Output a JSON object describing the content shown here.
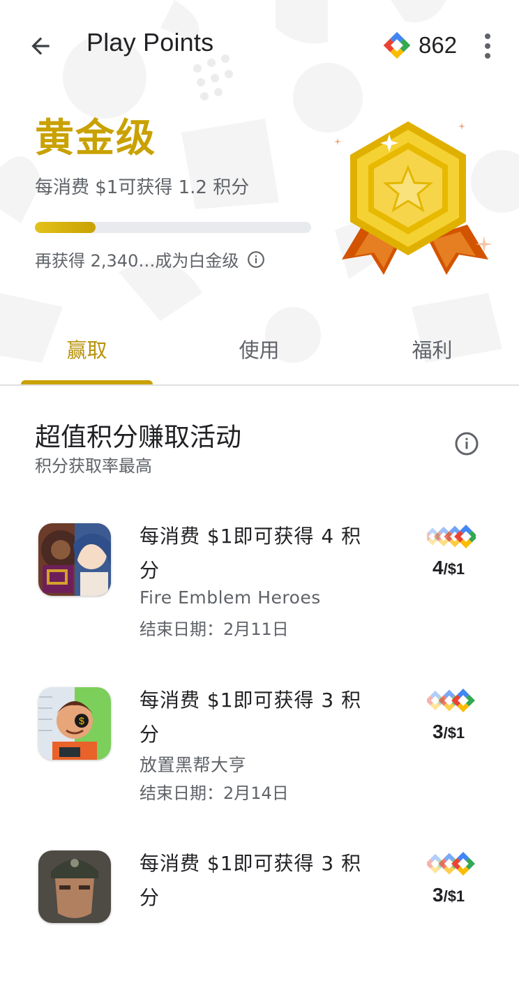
{
  "appbar": {
    "title": "Play Points",
    "points_balance": "862",
    "icons": {
      "back": "arrow-back-icon",
      "points": "play-points-icon",
      "menu": "more-vert-icon"
    }
  },
  "tier": {
    "name": "黄金级",
    "rate": "每消费 $1可获得 1.2 积分",
    "progress_fraction": 0.22,
    "next_level_text": "再获得 2,340…成为白金级",
    "accent_color": "#c9a100",
    "badge_icon": "gold-medal-icon"
  },
  "tabs": [
    {
      "label": "赢取",
      "active": true
    },
    {
      "label": "使用",
      "active": false
    },
    {
      "label": "福利",
      "active": false
    }
  ],
  "section": {
    "title": "超值积分赚取活动",
    "subtitle": "积分获取率最高"
  },
  "offers": [
    {
      "headline": "每消费 $1即可获得 4 积分",
      "app_name": "Fire Emblem Heroes",
      "end_date": "结束日期：2月11日",
      "rate_value": "4",
      "rate_unit": "/$1",
      "icon": "fire-emblem-heroes-app-icon"
    },
    {
      "headline": "每消费 $1即可获得 3 积分",
      "app_name": "放置黑帮大亨",
      "end_date": "结束日期：2月14日",
      "rate_value": "3",
      "rate_unit": "/$1",
      "icon": "idle-mafia-tycoon-app-icon"
    },
    {
      "headline": "每消费 $1即可获得 3 积分",
      "app_name": "",
      "end_date": "",
      "rate_value": "3",
      "rate_unit": "/$1",
      "icon": "soldier-game-app-icon"
    }
  ]
}
